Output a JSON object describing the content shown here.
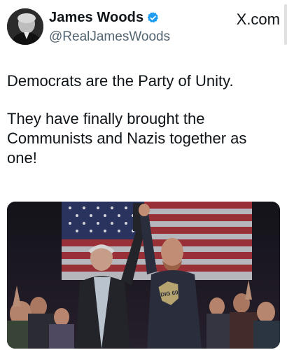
{
  "post": {
    "author": {
      "display_name": "James Woods",
      "handle": "@RealJamesWoods",
      "verified": true,
      "avatar_icon": "person-portrait-icon",
      "verified_color": "#1d9bf0"
    },
    "source_label": "X.com",
    "text": {
      "line1": "Democrats are the Party of Unity.",
      "line2": "They have finally brought the Communists and Nazis together as one!"
    },
    "media": {
      "type": "photo",
      "shirt_text": "DIG 60"
    }
  }
}
